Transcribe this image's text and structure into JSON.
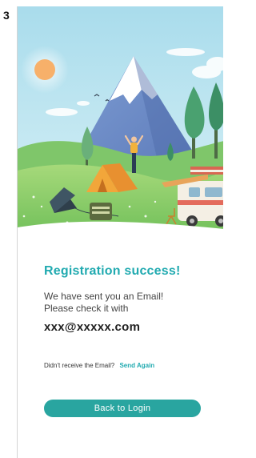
{
  "step": {
    "number": "3"
  },
  "hero": {
    "illustration": "camping-mountain-scene"
  },
  "content": {
    "title": "Registration success!",
    "message_line1": "We have sent you an Email!",
    "message_line2": "Please check it with",
    "email": "xxx@xxxxx.com"
  },
  "resend": {
    "prompt": "Didn't receive the Email?",
    "link": "Send Again"
  },
  "actions": {
    "back_label": "Back to Login"
  },
  "colors": {
    "accent": "#21aab0",
    "button": "#29a5a0",
    "sky": "#bfe6f2",
    "grass": "#8fcf6e"
  }
}
